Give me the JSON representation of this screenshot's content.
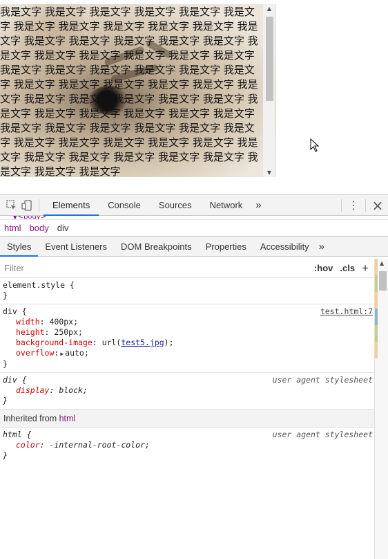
{
  "demo": {
    "repeated_text": "我是文字 我是文字 我是文字 我是文字 我是文字 我是文字 我是文字 我是文字 我是文字 我是文字 我是文字 我是文字 我是文字 我是文字 我是文字 我是文字 我是文字 我是文字 我是文字 我是文字 我是文字 我是文字 我是文字 我是文字 我是文字 我是文字 我是文字 我是文字 我是文字 我是文字 我是文字 我是文字 我是文字 我是文字 我是文字 我是文字 我是文字 我是文字 我是文字 我是文字 我是文字 我是文字 我是文字 我是文字 我是文字 我是文字 我是文字 我是文字 我是文字 我是文字 我是文字 我是文字 我是文字 我是文字 我是文字 我是文字 我是文字 我是文字 我是文字 我是文字 我是文字 我是文字 我是文字 我是文字 我是文字 我是文字"
  },
  "devtools": {
    "tabs": [
      "Elements",
      "Console",
      "Sources",
      "Network"
    ],
    "more_tabs": "»",
    "menu": "⋮",
    "close": "×",
    "dom_strip": "▼<body>",
    "breadcrumb": [
      "html",
      "body",
      "div"
    ],
    "subtabs": [
      "Styles",
      "Event Listeners",
      "DOM Breakpoints",
      "Properties",
      "Accessibility"
    ],
    "subtabs_more": "»",
    "filter_placeholder": "Filter",
    "hov": ":hov",
    "cls": ".cls",
    "add": "+",
    "rules": {
      "element_style": "element.style {",
      "element_close": "}",
      "div_selector": "div {",
      "div_source": "test.html:7",
      "width_name": "width",
      "width_val": "400px;",
      "height_name": "height",
      "height_val": "250px;",
      "bg_name": "background-image",
      "bg_url_prefix": "url(",
      "bg_url": "test5.jpg",
      "bg_url_suffix": ");",
      "overflow_name": "overflow",
      "overflow_val": "auto;",
      "div_close": "}",
      "ua_selector": "div {",
      "ua_source": "user agent stylesheet",
      "display_name": "display",
      "display_val": "block;",
      "ua_close": "}",
      "inherited_label": "Inherited from ",
      "inherited_tag": "html",
      "html_selector": "html {",
      "html_source": "user agent stylesheet",
      "color_name": "color",
      "color_val": "-internal-root-color;",
      "html_close": "}"
    }
  }
}
